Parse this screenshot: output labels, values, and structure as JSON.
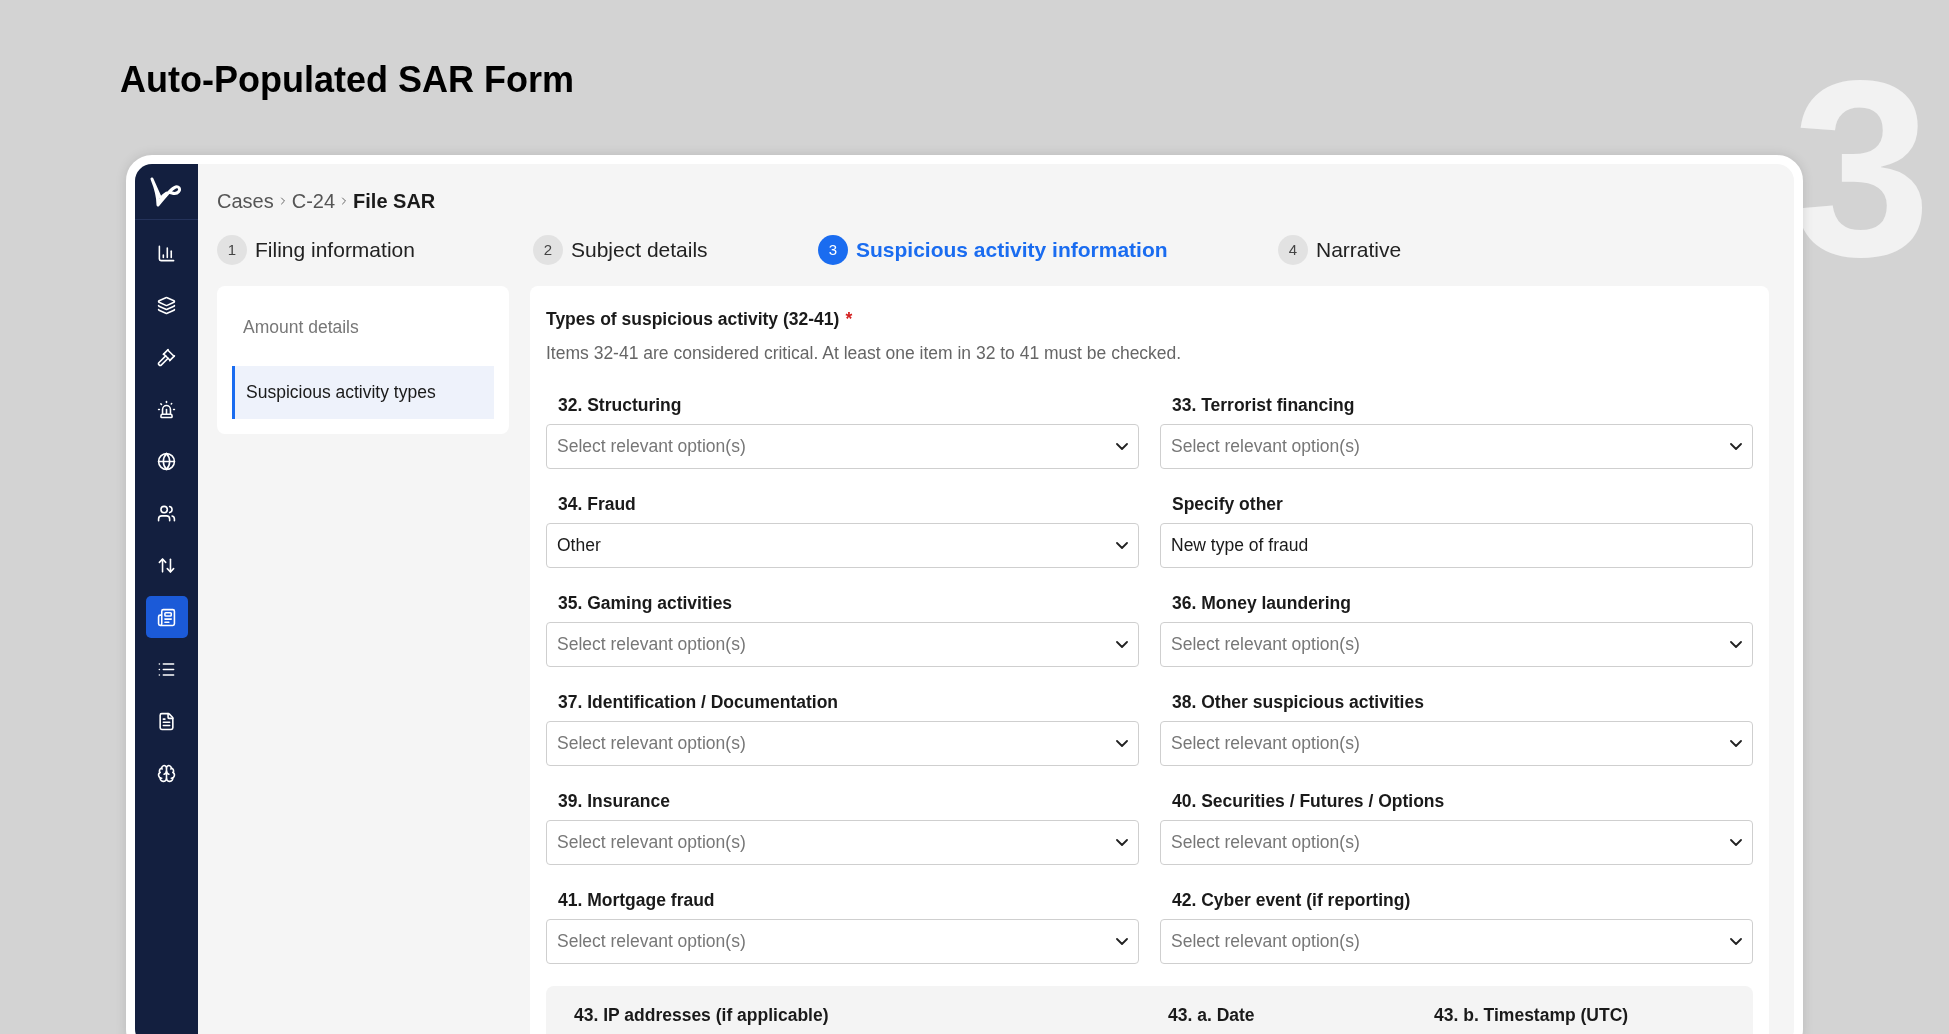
{
  "slide": {
    "title": "Auto-Populated SAR Form",
    "number": "3"
  },
  "sidebar": {
    "items": [
      {
        "selected": false
      },
      {
        "selected": false
      },
      {
        "selected": false
      },
      {
        "selected": false
      },
      {
        "selected": false
      },
      {
        "selected": false
      },
      {
        "selected": false
      },
      {
        "selected": true
      },
      {
        "selected": false
      },
      {
        "selected": false
      },
      {
        "selected": false
      }
    ]
  },
  "breadcrumb": [
    "Cases",
    "C-24",
    "File SAR"
  ],
  "steps": [
    {
      "number": "1",
      "label": "Filing information",
      "selected": false
    },
    {
      "number": "2",
      "label": "Subject details",
      "selected": false
    },
    {
      "number": "3",
      "label": "Suspicious activity information",
      "selected": true
    },
    {
      "number": "4",
      "label": "Narrative",
      "selected": false
    }
  ],
  "section_nav": [
    {
      "label": "Amount details",
      "selected": false
    },
    {
      "label": "Suspicious activity types",
      "selected": true
    }
  ],
  "form": {
    "heading": "Types of suspicious activity (32-41)",
    "required_mark": "*",
    "description": "Items 32-41 are considered critical. At least one item in 32 to 41 must be checked.",
    "fields": [
      {
        "label": "32. Structuring",
        "kind": "select",
        "placeholder": "Select relevant option(s)"
      },
      {
        "label": "33. Terrorist financing",
        "kind": "select",
        "placeholder": "Select relevant option(s)"
      },
      {
        "label": "34. Fraud",
        "kind": "select",
        "value": "Other"
      },
      {
        "label": "Specify other",
        "kind": "text",
        "value": "New type of fraud"
      },
      {
        "label": "35. Gaming activities",
        "kind": "select",
        "placeholder": "Select relevant option(s)"
      },
      {
        "label": "36. Money laundering",
        "kind": "select",
        "placeholder": "Select relevant option(s)"
      },
      {
        "label": "37. Identification / Documentation",
        "kind": "select",
        "placeholder": "Select relevant option(s)"
      },
      {
        "label": "38. Other suspicious activities",
        "kind": "select",
        "placeholder": "Select relevant option(s)"
      },
      {
        "label": "39. Insurance",
        "kind": "select",
        "placeholder": "Select relevant option(s)"
      },
      {
        "label": "40. Securities / Futures / Options",
        "kind": "select",
        "placeholder": "Select relevant option(s)"
      },
      {
        "label": "41. Mortgage fraud",
        "kind": "select",
        "placeholder": "Select relevant option(s)"
      },
      {
        "label": "42. Cyber event (if reporting)",
        "kind": "select",
        "placeholder": "Select relevant option(s)"
      }
    ],
    "cyber_labels": [
      "43. IP addresses (if applicable)",
      "43. a. Date",
      "43. b. Timestamp (UTC)"
    ]
  }
}
